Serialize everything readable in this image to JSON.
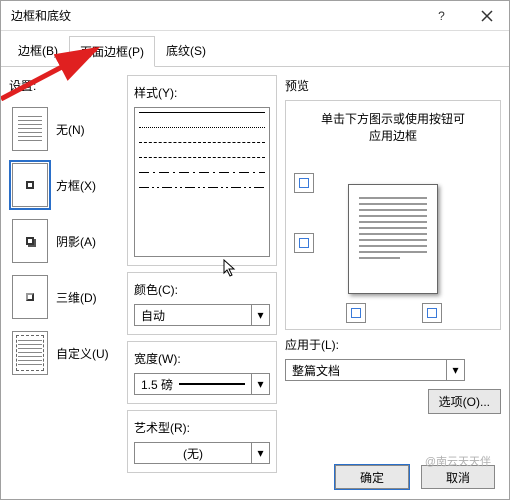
{
  "window": {
    "title": "边框和底纹"
  },
  "tabs": [
    {
      "label": "边框(B)"
    },
    {
      "label": "页面边框(P)"
    },
    {
      "label": "底纹(S)"
    }
  ],
  "active_tab": 1,
  "settings": {
    "label": "设置:",
    "items": [
      {
        "label": "无(N)"
      },
      {
        "label": "方框(X)"
      },
      {
        "label": "阴影(A)"
      },
      {
        "label": "三维(D)"
      },
      {
        "label": "自定义(U)"
      }
    ],
    "selected": 1
  },
  "style": {
    "label": "样式(Y):"
  },
  "color": {
    "label": "颜色(C):",
    "value": "自动"
  },
  "width": {
    "label": "宽度(W):",
    "value": "1.5 磅"
  },
  "art": {
    "label": "艺术型(R):",
    "value": "(无)"
  },
  "preview": {
    "label": "预览",
    "hint1": "单击下方图示或使用按钮可",
    "hint2": "应用边框"
  },
  "apply": {
    "label": "应用于(L):",
    "value": "整篇文档"
  },
  "options_btn": "选项(O)...",
  "footer": {
    "ok": "确定",
    "cancel": "取消"
  },
  "watermark": "@南云天天伴"
}
